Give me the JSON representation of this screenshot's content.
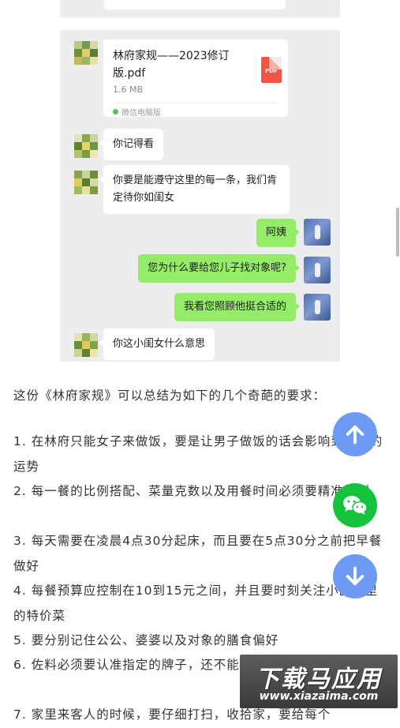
{
  "chat": {
    "file": {
      "name": "林府家规——2023修订版.pdf",
      "size": "1.6 MB",
      "icon_label": "PDF",
      "source": "微信电脑版"
    },
    "messages": [
      {
        "side": "left",
        "text": "你记得看"
      },
      {
        "side": "left",
        "text": "你要是能遵守这里的每一条，我们肯定待你如闺女"
      },
      {
        "side": "right",
        "text": "阿姨"
      },
      {
        "side": "right",
        "text": "您为什么要给您儿子找对象呢?"
      },
      {
        "side": "right",
        "text": "我看您照顾他挺合适的"
      },
      {
        "side": "left",
        "text": "你这小闺女什么意思"
      }
    ]
  },
  "article": {
    "intro": "这份《林府家规》可以总结为如下的几个奇葩的要求：",
    "items": [
      "1. 在林府只能女子来做饭，要是让男子做饭的话会影响到家族的运势",
      "2. 每一餐的比例搭配、菜量克数以及用餐时间必须要精准控制",
      "3. 每天需要在凌晨4点30分起床，而且要在5点30分之前把早餐做好",
      "4. 每餐预算应控制在10到15元之间，并且要时刻关注小区群里的特价菜",
      "5. 要分别记住公公、婆婆以及对象的膳食偏好",
      "6. 佐料必须要认准指定的牌子，还不能去超市买，只能去T宝买",
      "7. 家里来客人的时候，要仔细打扫，收拾家，要给每个"
    ]
  },
  "floating_buttons": {
    "scroll_up": "arrow-up-icon",
    "wechat": "wechat-icon",
    "scroll_down": "arrow-down-icon",
    "colors": {
      "scroll": "#6d9bf4",
      "wechat": "#15c23b"
    }
  },
  "watermark": {
    "title": "下载马应用",
    "url": "www.xiazaima.com"
  },
  "colors": {
    "chat_bg": "#ededed",
    "bubble_right": "#95ec69",
    "bubble_left": "#ffffff",
    "pdf_red": "#f05547"
  }
}
